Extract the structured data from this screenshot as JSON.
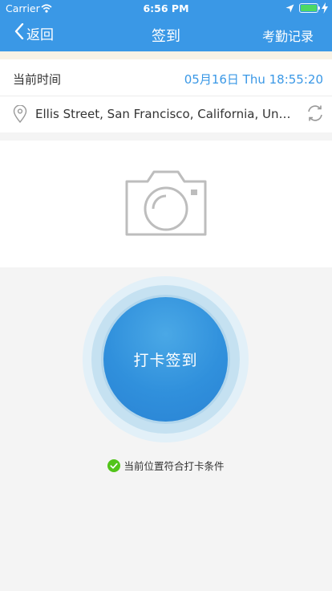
{
  "status_bar": {
    "carrier": "Carrier",
    "time": "6:56 PM",
    "battery_color": "#4cd964"
  },
  "nav": {
    "back_label": "返回",
    "title": "签到",
    "records_label": "考勤记录",
    "background_color": "#3a98e6"
  },
  "current_time": {
    "label": "当前时间",
    "value": "05月16日 Thu 18:55:20"
  },
  "location": {
    "address": "Ellis Street, San Francisco, California, United...",
    "pin_icon": "location-pin-icon",
    "refresh_icon": "refresh-icon"
  },
  "photo": {
    "icon": "camera-icon"
  },
  "checkin": {
    "button_label": "打卡签到",
    "status_text": "当前位置符合打卡条件",
    "status_icon": "check-circle-icon",
    "status_color": "#52c41a"
  }
}
